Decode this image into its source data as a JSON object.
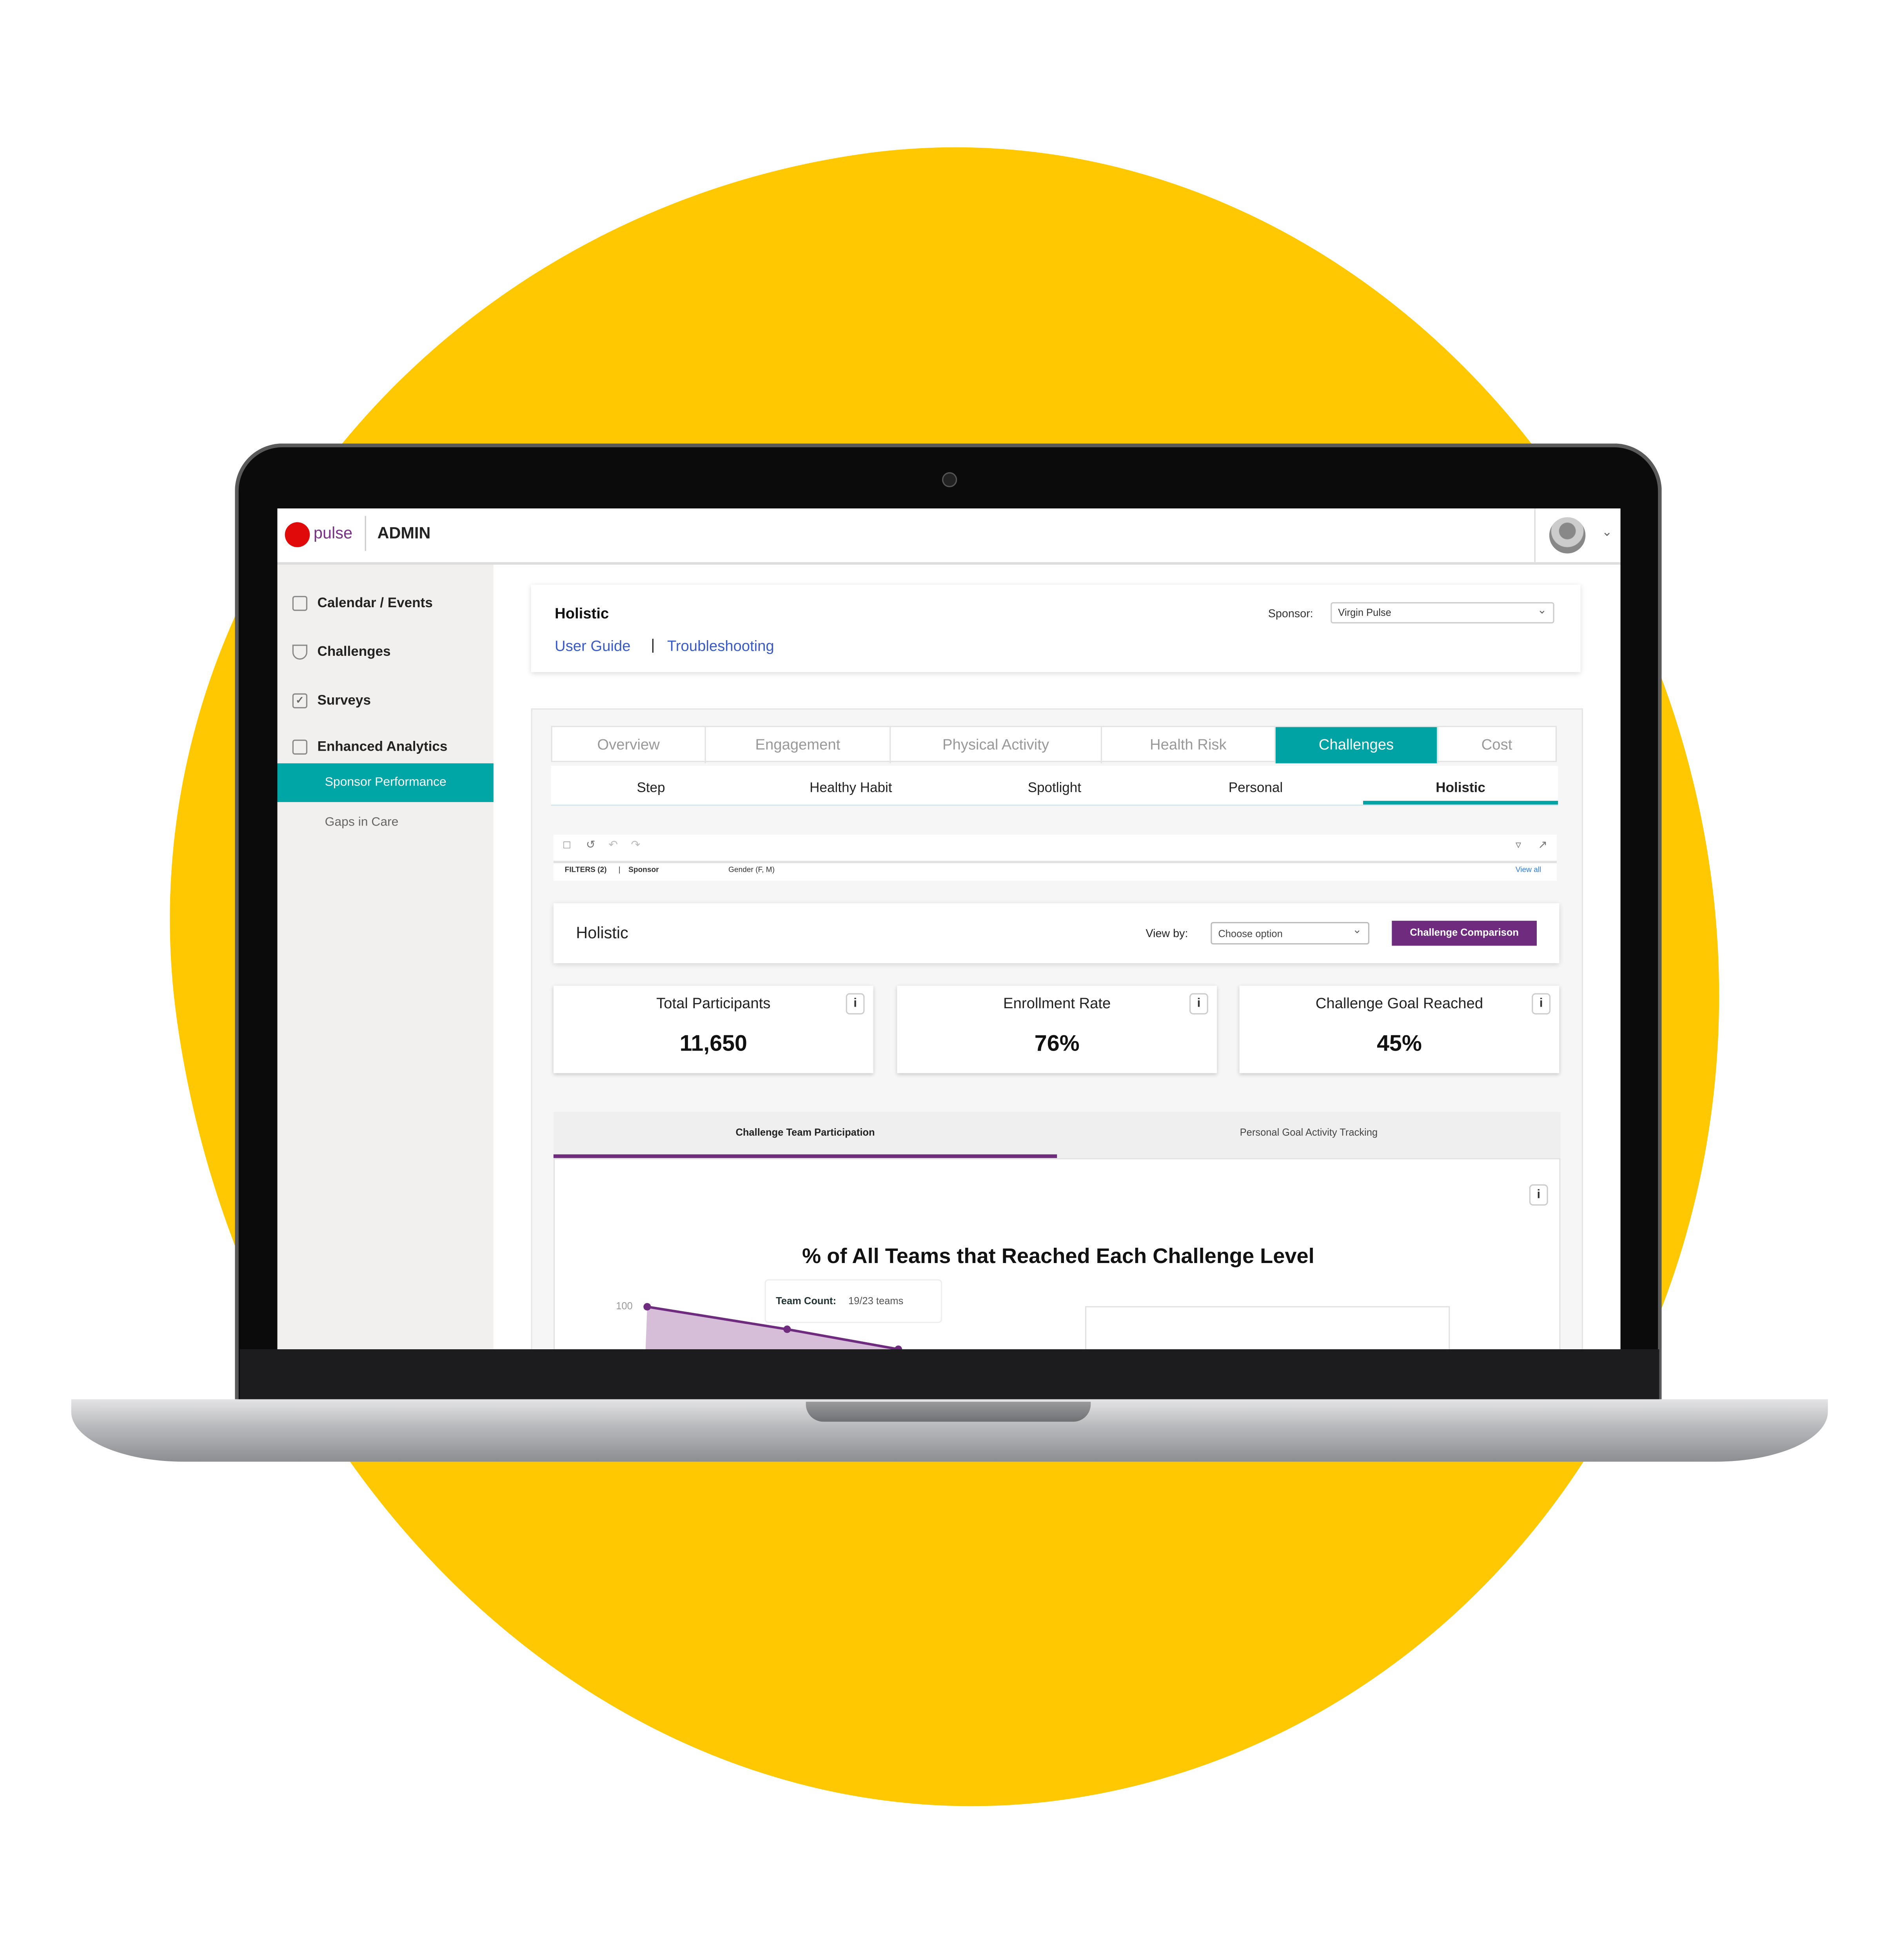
{
  "brand": {
    "logo_text": "pulse",
    "app_section": "ADMIN"
  },
  "sidebar": {
    "items": [
      {
        "label": "Calendar / Events",
        "icon": "calendar-icon"
      },
      {
        "label": "Challenges",
        "icon": "trophy-icon"
      },
      {
        "label": "Surveys",
        "icon": "clipboard-icon"
      },
      {
        "label": "Enhanced Analytics",
        "icon": "analytics-icon"
      }
    ],
    "subitems": [
      {
        "label": "Sponsor Performance",
        "active": true
      },
      {
        "label": "Gaps in Care",
        "active": false
      }
    ]
  },
  "header": {
    "title": "Holistic",
    "links": [
      "User Guide",
      "Troubleshooting"
    ],
    "separator": "|",
    "sponsor_label": "Sponsor:",
    "sponsor_value": "Virgin Pulse"
  },
  "tabs": [
    "Overview",
    "Engagement",
    "Physical Activity",
    "Health Risk",
    "Challenges",
    "Cost"
  ],
  "active_tab": "Challenges",
  "subtabs": [
    "Step",
    "Healthy Habit",
    "Spotlight",
    "Personal",
    "Holistic"
  ],
  "active_subtab": "Holistic",
  "filters": {
    "label": "FILTERS (2)",
    "sep": "|",
    "sponsor": "Sponsor",
    "gender": "Gender (F, M)",
    "view_all": "View all"
  },
  "section": {
    "title": "Holistic",
    "view_by_label": "View by:",
    "view_by_placeholder": "Choose option",
    "compare_button": "Challenge Comparison"
  },
  "kpis": [
    {
      "title": "Total Participants",
      "value": "11,650"
    },
    {
      "title": "Enrollment Rate",
      "value": "76%"
    },
    {
      "title": "Challenge Goal Reached",
      "value": "45%"
    }
  ],
  "chart_tabs": [
    "Challenge Team Participation",
    "Personal Goal Activity Tracking"
  ],
  "chart": {
    "title": "% of All Teams that Reached Each Challenge Level",
    "y_tick": "100",
    "tooltip_label": "Team Count:",
    "tooltip_value": "19/23 teams"
  },
  "colors": {
    "accent_teal": "#00a3a3",
    "accent_purple": "#6f2c7f",
    "background_yellow": "#ffc800",
    "link_blue": "#3a5bc7"
  }
}
